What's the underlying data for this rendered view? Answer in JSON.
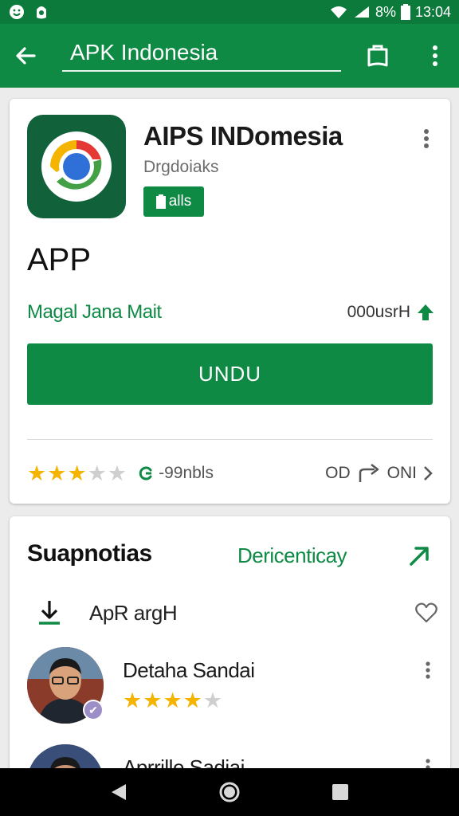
{
  "status_bar": {
    "battery": "8%",
    "time": "13:04"
  },
  "search": {
    "query": "APK Indonesia"
  },
  "app": {
    "title": "AIPS INDomesia",
    "developer": "Drgdoiaks",
    "badge": "alls",
    "type": "APP",
    "maker_link": "Magal Jana Mait",
    "size": "000usrH",
    "install_label": "UNDU",
    "review_count": "-99nbls",
    "rating_right": "OD",
    "share_label": "ONI"
  },
  "section": {
    "title": "Suapnotias",
    "link": "Dericenticay",
    "download_label": "ApR argH"
  },
  "reviews": [
    {
      "name": "Detaha Sandai"
    },
    {
      "name": "Aprrille Sadiai"
    }
  ],
  "colors": {
    "primary": "#0e8a45",
    "primary_dark": "#0b7a3b",
    "star": "#f4b400"
  }
}
